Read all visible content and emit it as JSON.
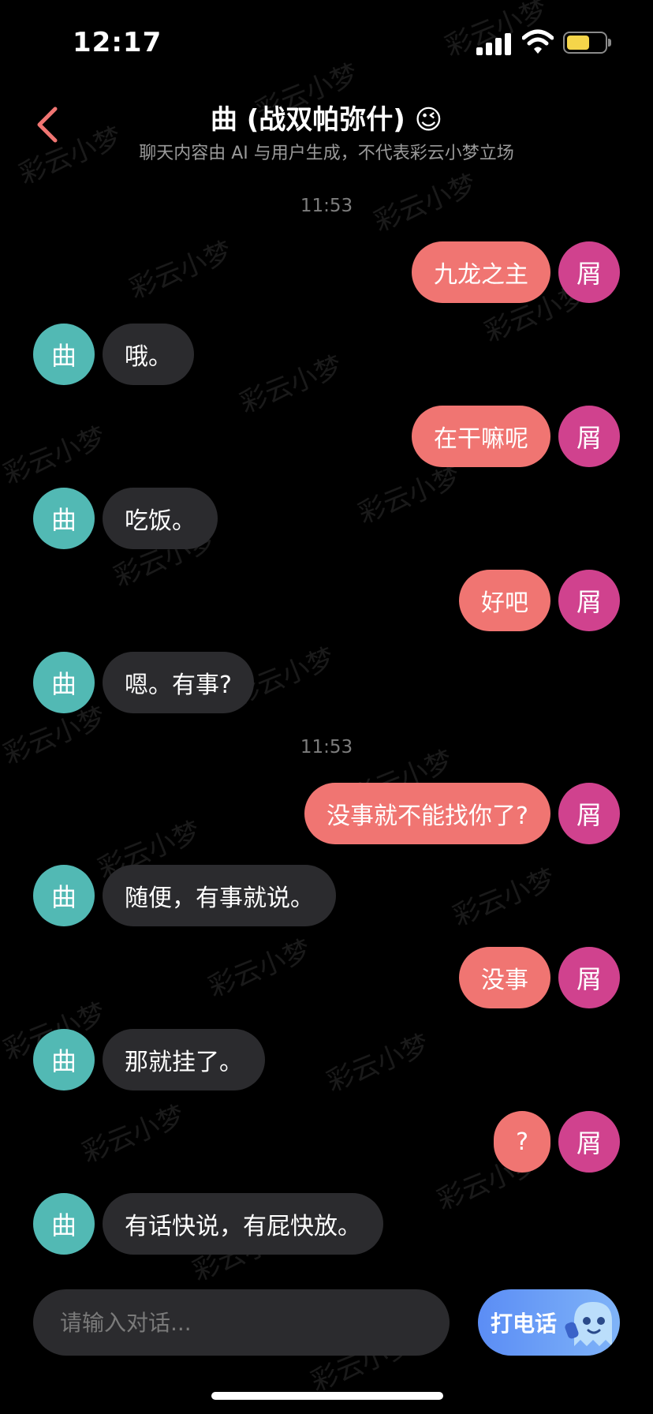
{
  "status_bar": {
    "time": "12:17",
    "battery_color": "#f5d54a"
  },
  "header": {
    "title": "曲 (战双帕弥什) 😉",
    "subtitle": "聊天内容由 AI 与用户生成，不代表彩云小梦立场",
    "accent": "#f07572"
  },
  "colors": {
    "user_bubble": "#f07572",
    "user_avatar": "#d0428e",
    "bot_avatar": "#52b9b4"
  },
  "watermark": "彩云小梦",
  "timestamps": [
    "11:53",
    "11:53"
  ],
  "messages": [
    {
      "role": "user",
      "avatar": "屑",
      "text": "九龙之主"
    },
    {
      "role": "bot",
      "avatar": "曲",
      "text": "哦。"
    },
    {
      "role": "user",
      "avatar": "屑",
      "text": "在干嘛呢"
    },
    {
      "role": "bot",
      "avatar": "曲",
      "text": "吃饭。"
    },
    {
      "role": "user",
      "avatar": "屑",
      "text": "好吧"
    },
    {
      "role": "bot",
      "avatar": "曲",
      "text": "嗯。有事?"
    },
    {
      "role": "user",
      "avatar": "屑",
      "text": "没事就不能找你了?"
    },
    {
      "role": "bot",
      "avatar": "曲",
      "text": "随便，有事就说。"
    },
    {
      "role": "user",
      "avatar": "屑",
      "text": "没事"
    },
    {
      "role": "bot",
      "avatar": "曲",
      "text": "那就挂了。"
    },
    {
      "role": "user",
      "avatar": "屑",
      "text": "?"
    },
    {
      "role": "bot",
      "avatar": "曲",
      "text": "有话快说，有屁快放。"
    }
  ],
  "input": {
    "placeholder": "请输入对话..."
  },
  "call_button": {
    "label": "打电话"
  }
}
